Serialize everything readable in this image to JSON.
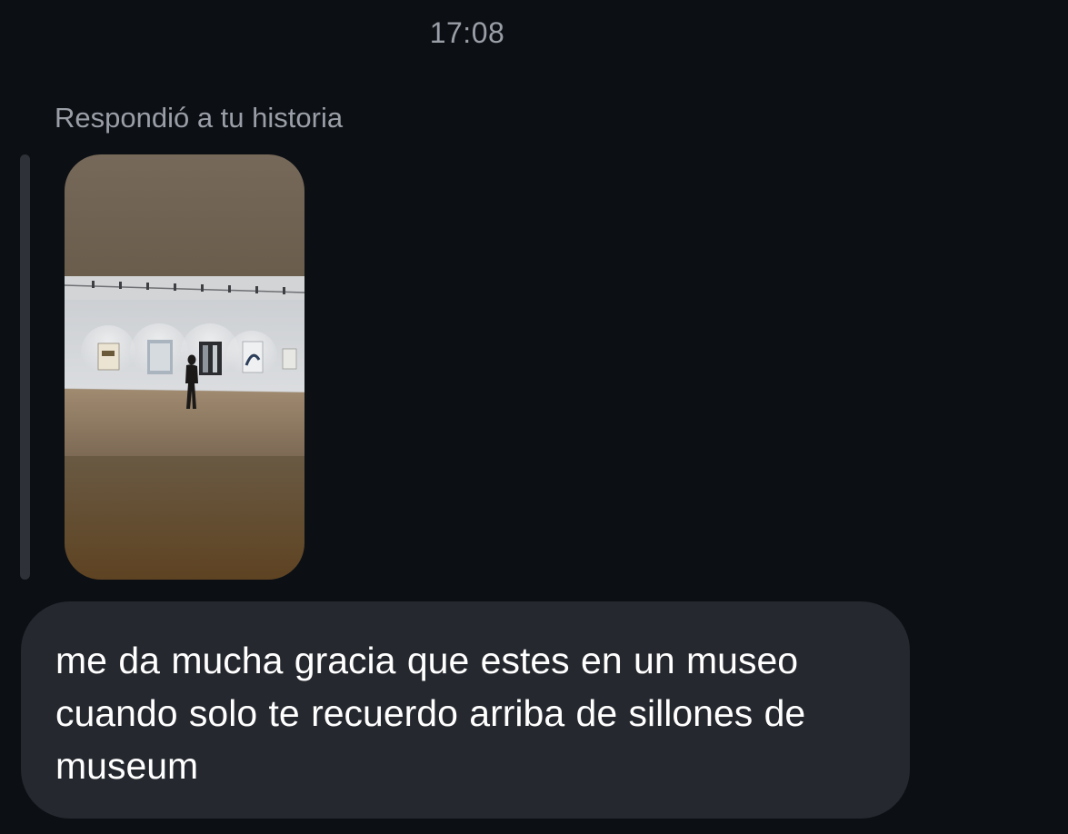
{
  "conversation": {
    "timestamp": "17:08",
    "reply_context": {
      "label": "Respondió a tu historia",
      "story_thumbnail": {
        "kind": "photo",
        "scene": "art-gallery",
        "colors": {
          "top": "#77695a",
          "bottom": "#5e4322",
          "wall": "#d9dcdf",
          "floor": "#8a7660"
        }
      }
    },
    "message": {
      "text": "me da mucha gracia que estes en un museo cuando solo te recuerdo arriba de sillones de museum",
      "bubble_color": "#25282e",
      "text_color": "#ffffff"
    }
  },
  "theme": {
    "background": "#0c0f14",
    "secondary_text": "#9a9ea6",
    "reply_bar": "#2e3238"
  }
}
